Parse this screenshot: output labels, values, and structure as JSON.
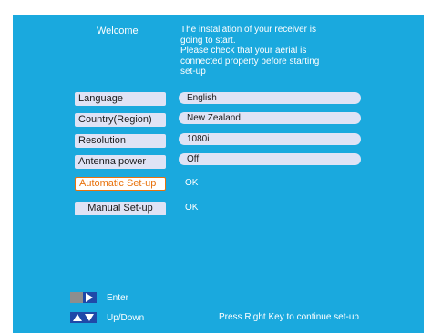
{
  "welcome": "Welcome",
  "intro_lines": [
    "The installation of your receiver is",
    "going to start.",
    "Please check that your aerial is",
    "connected property before starting",
    "set-up"
  ],
  "settings": [
    {
      "label": "Language",
      "value": "English"
    },
    {
      "label": "Country(Region)",
      "value": "New Zealand"
    },
    {
      "label": "Resolution",
      "value": "1080i"
    },
    {
      "label": "Antenna power",
      "value": "Off"
    }
  ],
  "actions": [
    {
      "label": "Automatic Set-up",
      "value": "OK",
      "state": "selected"
    },
    {
      "label": "Manual  Set-up",
      "value": "OK"
    }
  ],
  "legend": {
    "enter_label": "Enter",
    "updown_label": "Up/Down"
  },
  "hint": "Press Right Key to continue set-up",
  "colors": {
    "screen_bg": "#1aa9de",
    "button_bg": "#dfe3f5",
    "highlight": "#e8720c",
    "key_blue": "#1f49a8"
  },
  "icons": [
    "right-arrow-key-icon",
    "up-down-arrow-key-icon"
  ]
}
